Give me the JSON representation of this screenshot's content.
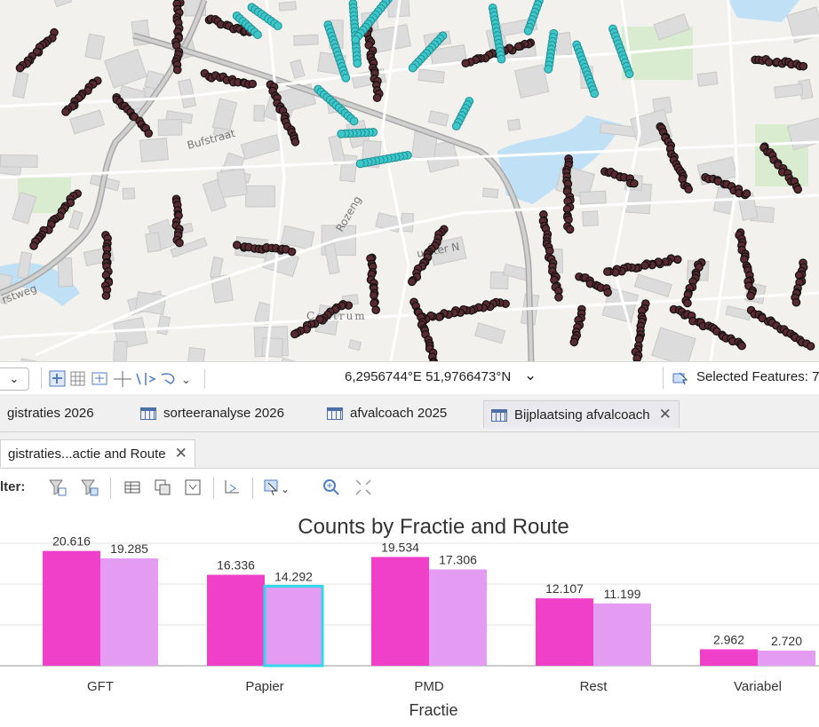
{
  "map": {
    "label_road1": "Bufstraat",
    "label_road2": "Rozeng",
    "label_road3": "urster N",
    "label_road4": "rstweg",
    "label_center": "Centrum"
  },
  "status": {
    "coordinates": "6,2956744°E 51,9766473°N",
    "coord_dropdown": "⌄",
    "selected_features": "Selected Features: 7"
  },
  "tabs": [
    {
      "label": "gistraties 2026"
    },
    {
      "label": "sorteeranalyse 2026"
    },
    {
      "label": "afvalcoach 2025"
    },
    {
      "label": "Bijplaatsing afvalcoach",
      "close": "✕"
    }
  ],
  "chart_tab": {
    "label": "gistraties...actie and Route",
    "close": "✕"
  },
  "toolbar": {
    "filter_label": "lter:"
  },
  "colors": {
    "series1": "#f03fc9",
    "series2": "#e49cf3",
    "highlight": "#2fd7e8",
    "map_teal": "#3cc7c9",
    "map_point": "#5a2a30"
  },
  "chart_data": {
    "type": "bar",
    "title": "Counts by Fractie and Route",
    "xlabel": "Fractie",
    "ylabel": "",
    "categories": [
      "GFT",
      "Papier",
      "PMD",
      "Rest",
      "Variabel"
    ],
    "series": [
      {
        "values": [
          20616,
          16336,
          19534,
          12107,
          2962
        ],
        "labels": [
          "20.616",
          "16.336",
          "19.534",
          "12.107",
          "2.962"
        ]
      },
      {
        "values": [
          19285,
          14292,
          17306,
          11199,
          2720
        ],
        "labels": [
          "19.285",
          "14.292",
          "17.306",
          "11.199",
          "2.720"
        ]
      }
    ],
    "highlighted": {
      "series": 1,
      "category": 1
    },
    "ylim": [
      0,
      22000
    ],
    "grid": true,
    "legend": "none"
  }
}
